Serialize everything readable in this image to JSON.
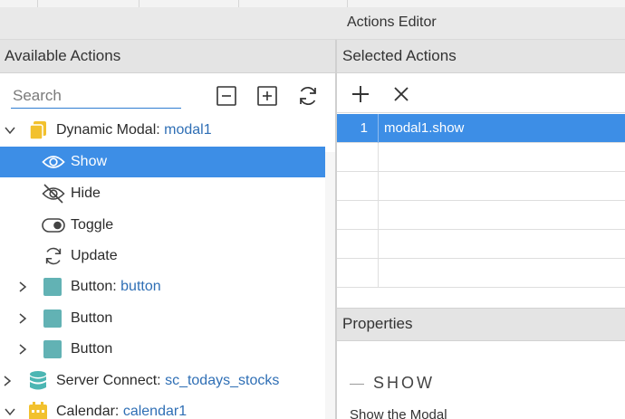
{
  "window": {
    "title": "Actions Editor"
  },
  "left_panel": {
    "title": "Available Actions",
    "search": {
      "placeholder": "Search",
      "value": ""
    },
    "tools": [
      {
        "name": "collapse-all",
        "icon": "minus-square-icon"
      },
      {
        "name": "expand-all",
        "icon": "plus-square-icon"
      },
      {
        "name": "refresh",
        "icon": "refresh-icon"
      }
    ],
    "tree": [
      {
        "prefix": "Dynamic Modal: ",
        "link": "modal1",
        "icon": "modal-icon",
        "expanded": true
      },
      {
        "label": "Show",
        "icon": "eye-icon",
        "selected": true
      },
      {
        "label": "Hide",
        "icon": "eye-off-icon"
      },
      {
        "label": "Toggle",
        "icon": "toggle-icon"
      },
      {
        "label": "Update",
        "icon": "refresh-icon"
      },
      {
        "prefix": "Button: ",
        "link": "button",
        "icon": "component-icon",
        "expanded": false
      },
      {
        "label": "Button",
        "icon": "component-icon",
        "expanded": false
      },
      {
        "label": "Button",
        "icon": "component-icon",
        "expanded": false
      },
      {
        "prefix": "Server Connect: ",
        "link": "sc_todays_stocks",
        "icon": "database-icon",
        "expanded": false
      },
      {
        "prefix": "Calendar: ",
        "link": "calendar1",
        "icon": "calendar-icon",
        "expanded": true
      }
    ]
  },
  "right_panel": {
    "title": "Selected Actions",
    "tools": [
      {
        "name": "add",
        "icon": "plus-icon"
      },
      {
        "name": "remove",
        "icon": "close-icon"
      }
    ],
    "actions": [
      {
        "index": "1",
        "value": "modal1.show",
        "selected": true
      },
      {
        "index": "",
        "value": ""
      },
      {
        "index": "",
        "value": ""
      },
      {
        "index": "",
        "value": ""
      },
      {
        "index": "",
        "value": ""
      },
      {
        "index": "",
        "value": ""
      }
    ],
    "properties": {
      "title": "Properties",
      "section": "SHOW",
      "description": "Show the Modal"
    }
  },
  "colors": {
    "accent": "#3d8ee6",
    "link": "#2f6fb5",
    "modal_icon": "#f2c12e",
    "component_icon": "#62b2b4",
    "database_icon": "#4cb6b3",
    "calendar_icon": "#f2c12e"
  }
}
